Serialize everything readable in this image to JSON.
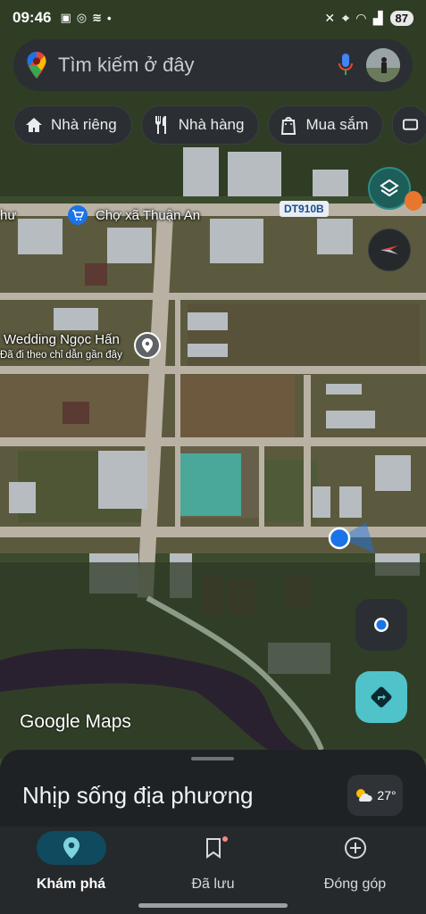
{
  "status_bar": {
    "time": "09:46",
    "battery": "87"
  },
  "search": {
    "placeholder": "Tìm kiếm ở đây"
  },
  "chips": [
    {
      "label": "Nhà riêng",
      "icon": "home-icon"
    },
    {
      "label": "Nhà hàng",
      "icon": "fork-knife-icon"
    },
    {
      "label": "Mua sắm",
      "icon": "shopping-bag-icon"
    }
  ],
  "map": {
    "place_labels": [
      {
        "label": "Chợ xã Thuận An",
        "icon": "shopping-cart-icon"
      },
      {
        "label": "Wedding Ngọc Hấn",
        "sublabel": "Đã đi theo chỉ dẫn gần đây",
        "icon": "history-pin-icon"
      }
    ],
    "truncated_label": "hư",
    "road_shield": "DT910B",
    "attribution": "Google Maps"
  },
  "sheet": {
    "title": "Nhịp sống địa phương",
    "temperature": "27°"
  },
  "bottom_nav": [
    {
      "label": "Khám phá",
      "icon": "explore-pin-icon",
      "active": true
    },
    {
      "label": "Đã lưu",
      "icon": "bookmark-icon",
      "active": false
    },
    {
      "label": "Đóng góp",
      "icon": "add-circle-icon",
      "active": false
    }
  ],
  "colors": {
    "accent_teal": "#0f4a5e",
    "directions_button": "#4fc3c9",
    "location_dot": "#1a73e8"
  }
}
